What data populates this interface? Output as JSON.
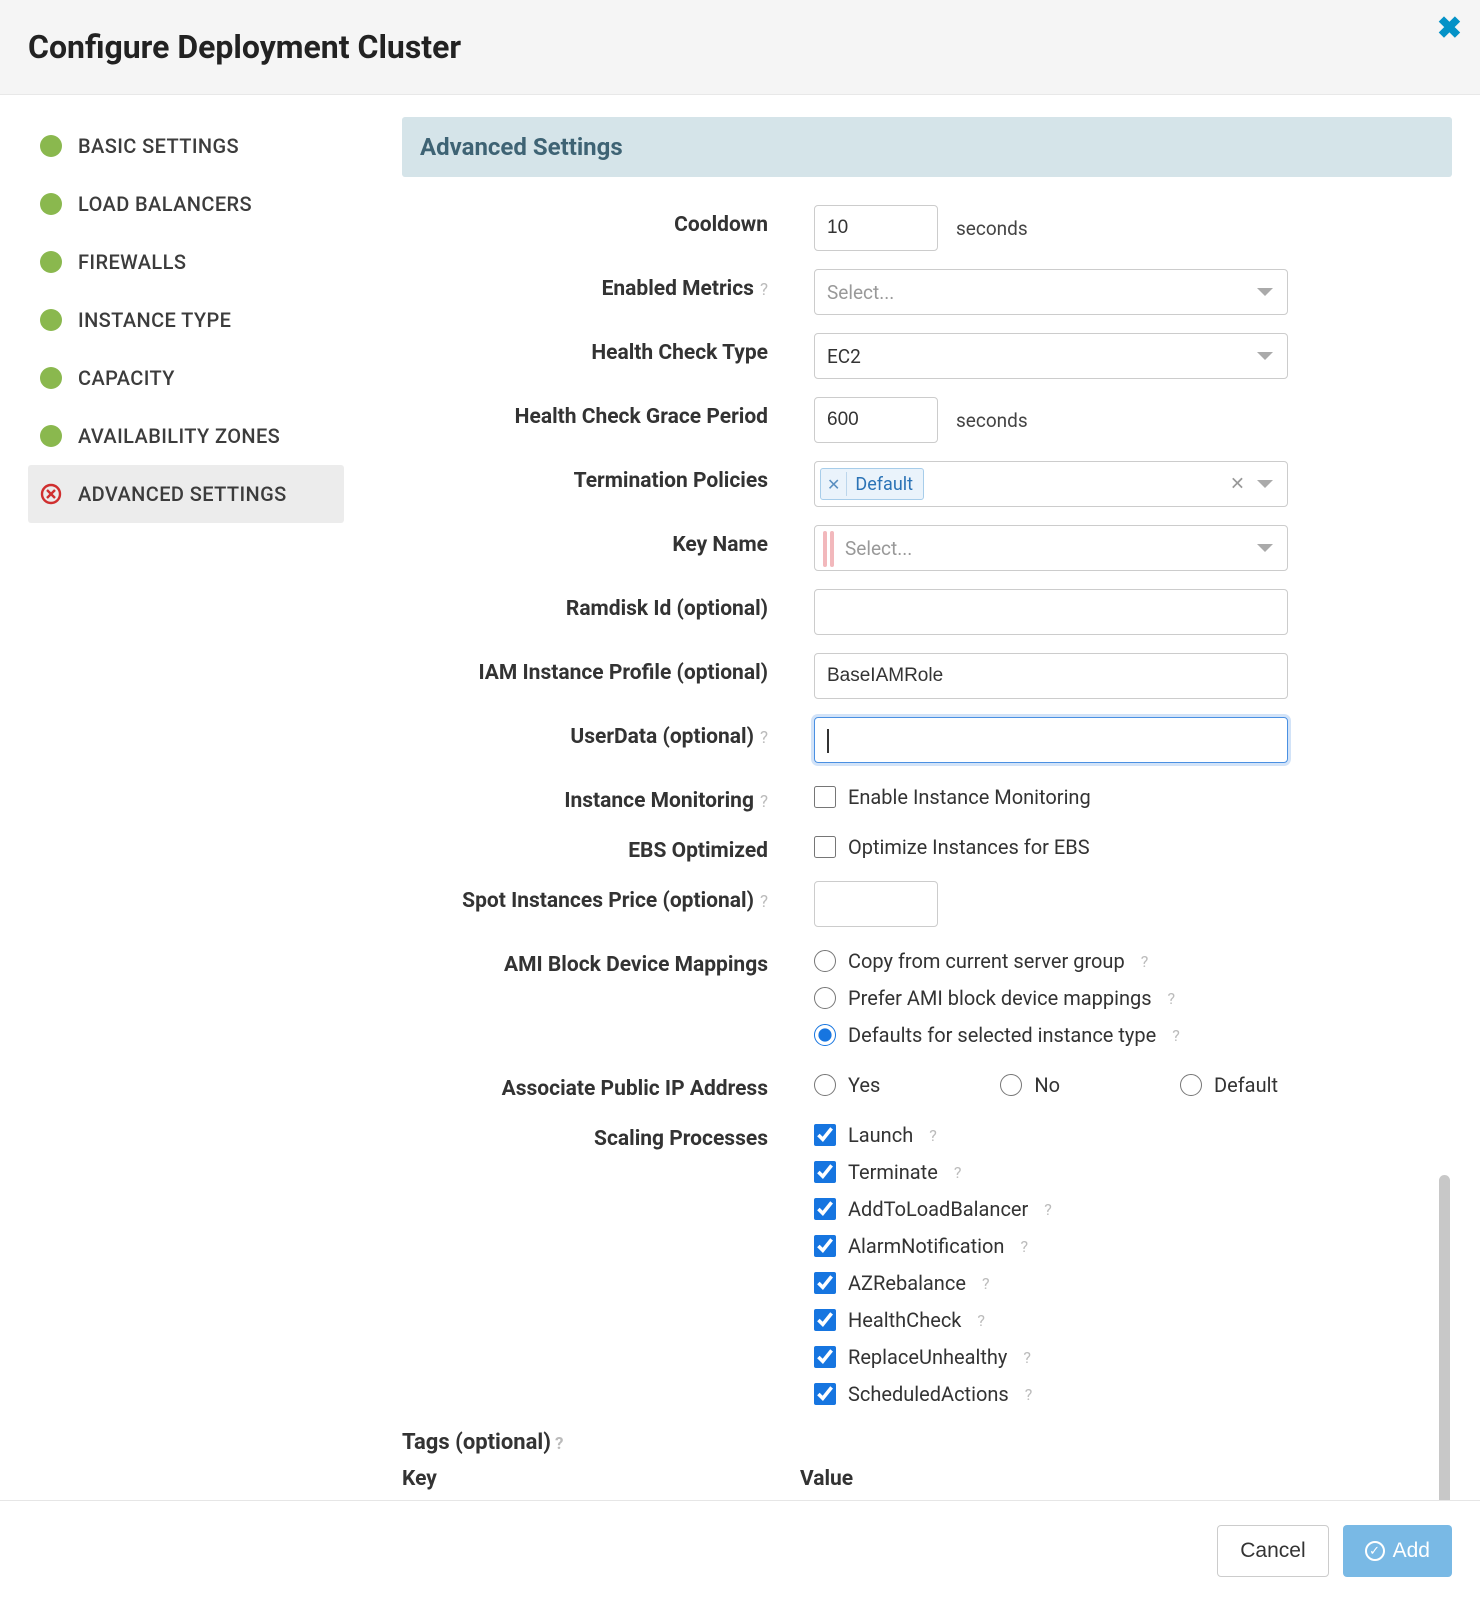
{
  "modal": {
    "title": "Configure Deployment Cluster"
  },
  "sidebar": {
    "items": [
      {
        "label": "BASIC SETTINGS",
        "state": "done"
      },
      {
        "label": "LOAD BALANCERS",
        "state": "done"
      },
      {
        "label": "FIREWALLS",
        "state": "done"
      },
      {
        "label": "INSTANCE TYPE",
        "state": "done"
      },
      {
        "label": "CAPACITY",
        "state": "done"
      },
      {
        "label": "AVAILABILITY ZONES",
        "state": "done"
      },
      {
        "label": "ADVANCED SETTINGS",
        "state": "error",
        "active": true
      }
    ]
  },
  "section": {
    "title": "Advanced Settings"
  },
  "labels": {
    "cooldown": "Cooldown",
    "enabledMetrics": "Enabled Metrics",
    "healthCheckType": "Health Check Type",
    "healthCheckGrace": "Health Check Grace Period",
    "terminationPolicies": "Termination Policies",
    "keyName": "Key Name",
    "ramdisk": "Ramdisk Id (optional)",
    "iamProfile": "IAM Instance Profile (optional)",
    "userData": "UserData (optional)",
    "instanceMonitoring": "Instance Monitoring",
    "ebsOptimized": "EBS Optimized",
    "spotPrice": "Spot Instances Price (optional)",
    "amiBlock": "AMI Block Device Mappings",
    "publicIp": "Associate Public IP Address",
    "scaling": "Scaling Processes",
    "tags": "Tags (optional)",
    "tagsKey": "Key",
    "tagsValue": "Value"
  },
  "values": {
    "cooldown": "10",
    "secondsSuffix": "seconds",
    "enabledMetricsPlaceholder": "Select...",
    "healthCheckType": "EC2",
    "healthCheckGrace": "600",
    "terminationPoliciesTag": "Default",
    "keyNamePlaceholder": "Select...",
    "ramdisk": "",
    "iamProfile": "BaseIAMRole",
    "userData": "",
    "instanceMonitoringLabel": "Enable Instance Monitoring",
    "ebsOptimizedLabel": "Optimize Instances for EBS",
    "spotPrice": ""
  },
  "amiOptions": [
    {
      "label": "Copy from current server group",
      "checked": false,
      "help": true
    },
    {
      "label": "Prefer AMI block device mappings",
      "checked": false,
      "help": true
    },
    {
      "label": "Defaults for selected instance type",
      "checked": true,
      "help": true
    }
  ],
  "publicIpOptions": [
    {
      "label": "Yes",
      "checked": false
    },
    {
      "label": "No",
      "checked": false
    },
    {
      "label": "Default",
      "checked": false
    }
  ],
  "scalingProcesses": [
    {
      "label": "Launch",
      "checked": true,
      "help": true
    },
    {
      "label": "Terminate",
      "checked": true,
      "help": true
    },
    {
      "label": "AddToLoadBalancer",
      "checked": true,
      "help": true
    },
    {
      "label": "AlarmNotification",
      "checked": true,
      "help": true
    },
    {
      "label": "AZRebalance",
      "checked": true,
      "help": true
    },
    {
      "label": "HealthCheck",
      "checked": true,
      "help": true
    },
    {
      "label": "ReplaceUnhealthy",
      "checked": true,
      "help": true
    },
    {
      "label": "ScheduledActions",
      "checked": true,
      "help": true
    }
  ],
  "footer": {
    "cancel": "Cancel",
    "add": "Add"
  }
}
